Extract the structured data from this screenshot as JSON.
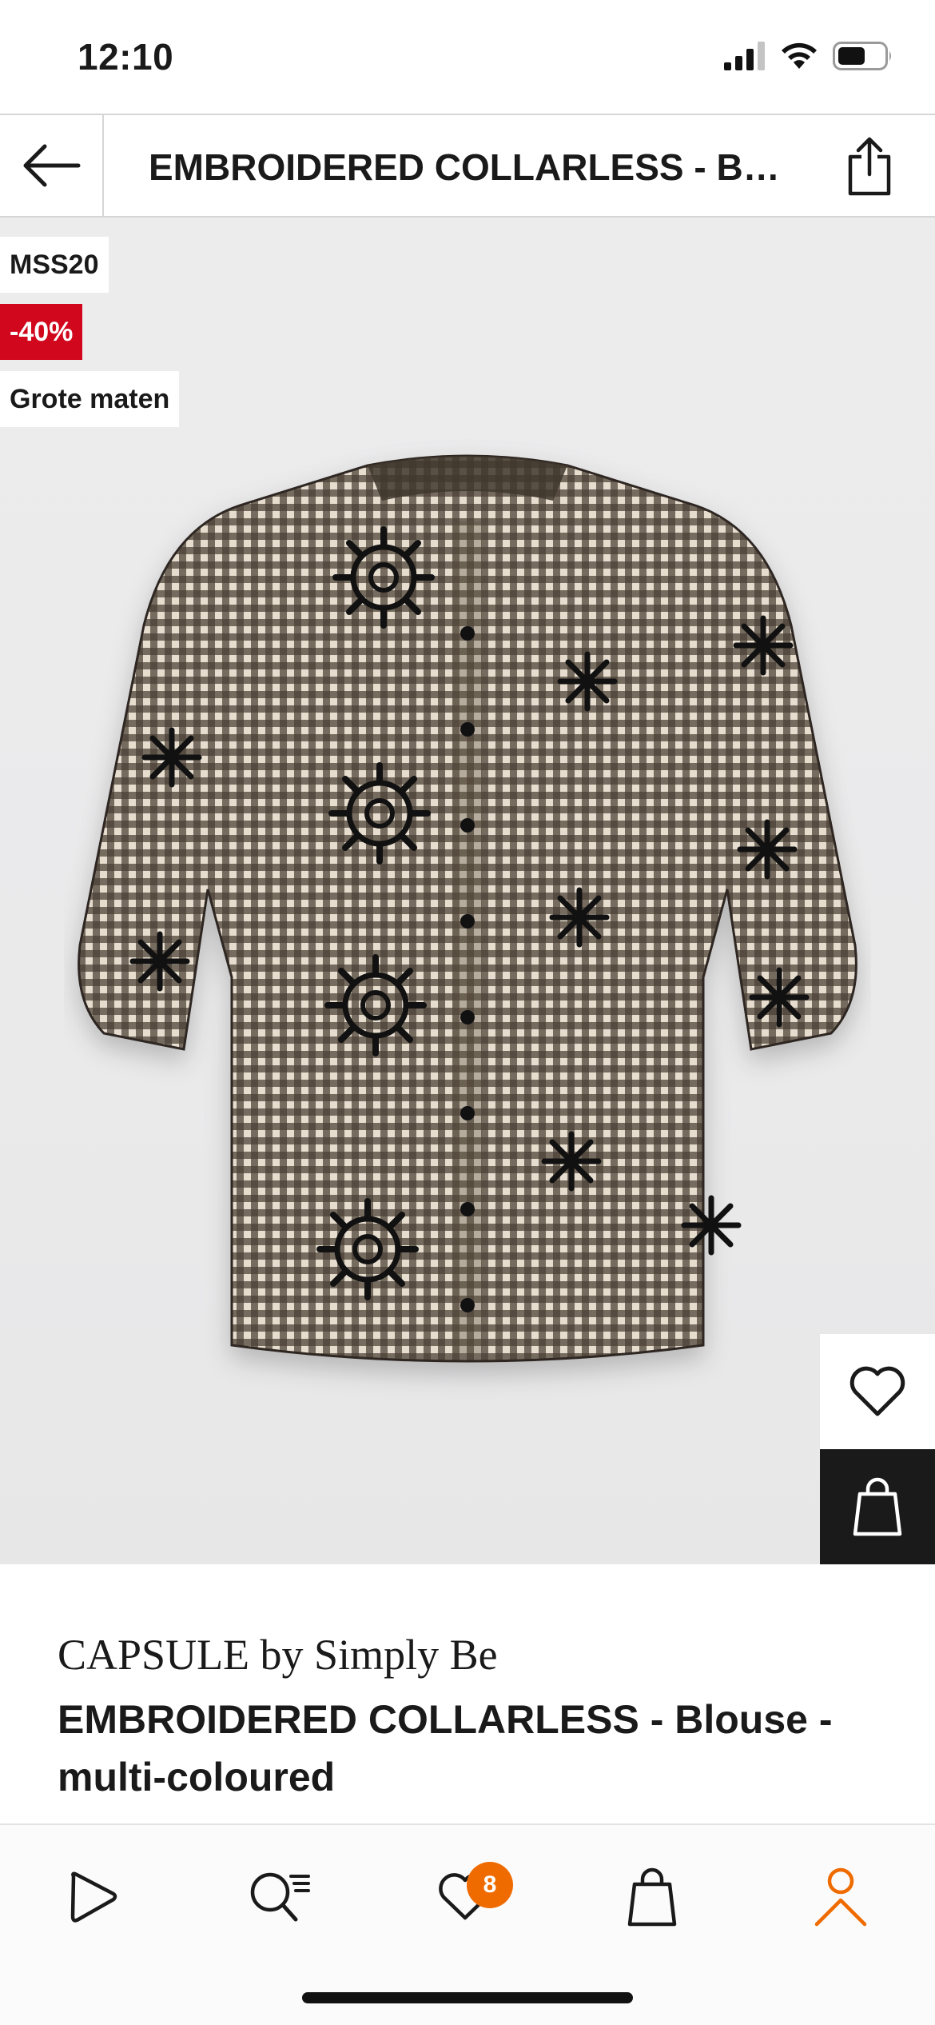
{
  "status_bar": {
    "time": "12:10",
    "icons": [
      "signal-icon",
      "wifi-icon",
      "battery-icon"
    ]
  },
  "header": {
    "back_icon": "arrow-left-icon",
    "title": "EMBROIDERED COLLARLESS - BI...",
    "share_icon": "share-icon"
  },
  "gallery": {
    "badges": {
      "code": "MSS20",
      "discount": "-40%",
      "size": "Grote maten"
    },
    "image": "multi-coloured gingham blouse with black embroidery",
    "progress": 0.33,
    "wishlist_icon": "heart-icon",
    "add_to_bag_icon": "shopping-bag-icon"
  },
  "product": {
    "brand": "CAPSULE by Simply Be",
    "name": "EMBROIDERED COLLARLESS - Blouse - multi-coloured"
  },
  "tab_bar": {
    "items": [
      {
        "name": "home",
        "icon": "home-icon"
      },
      {
        "name": "search",
        "icon": "search-icon"
      },
      {
        "name": "wishlist",
        "icon": "heart-icon",
        "badge": "8"
      },
      {
        "name": "bag",
        "icon": "shopping-bag-icon"
      },
      {
        "name": "account",
        "icon": "person-icon",
        "active": true
      }
    ]
  },
  "colors": {
    "discount_red": "#d1081d",
    "accent_orange": "#ef6b00",
    "text": "#1a1a1a"
  }
}
